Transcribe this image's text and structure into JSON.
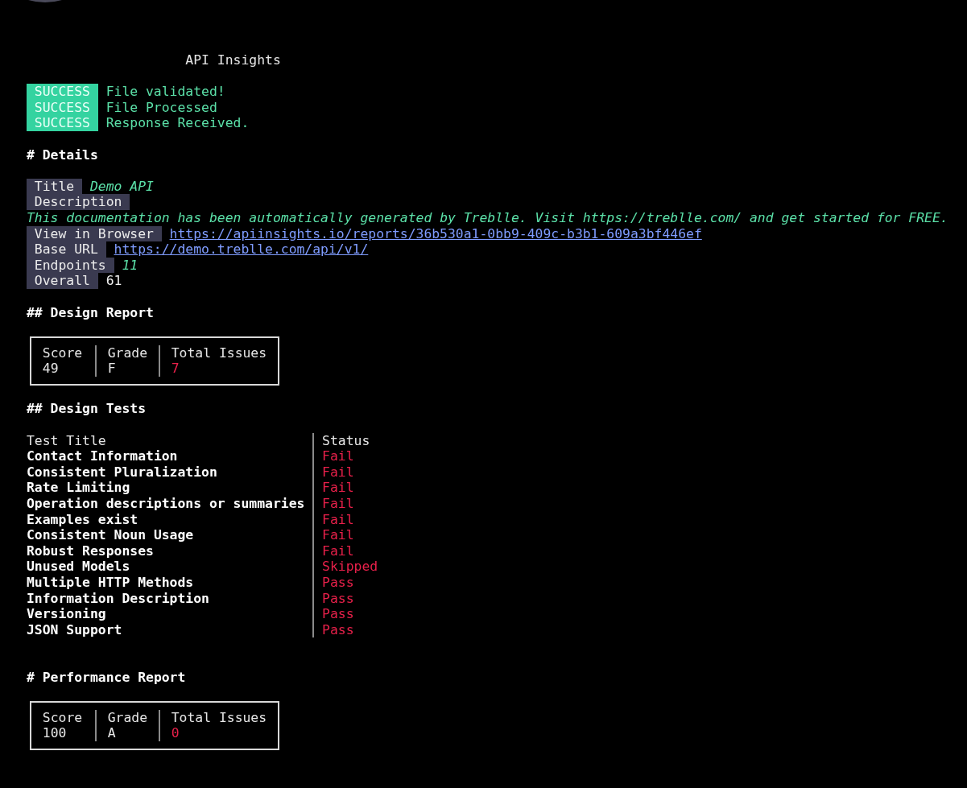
{
  "title": "API Insights",
  "log": [
    {
      "badge": "SUCCESS",
      "message": "File validated!"
    },
    {
      "badge": "SUCCESS",
      "message": "File Processed"
    },
    {
      "badge": "SUCCESS",
      "message": "Response Received."
    }
  ],
  "details": {
    "heading": "# Details",
    "fields": [
      {
        "label": "Title",
        "value": "Demo API",
        "kind": "italic"
      },
      {
        "label": "Description",
        "value": "This documentation has been automatically generated by Treblle. Visit https://treblle.com/ and get started for FREE.",
        "kind": "block"
      },
      {
        "label": "View in Browser",
        "value": "https://apiinsights.io/reports/36b530a1-0bb9-409c-b3b1-609a3bf446ef",
        "kind": "link"
      },
      {
        "label": "Base URL",
        "value": "https://demo.treblle.com/api/v1/",
        "kind": "link"
      },
      {
        "label": "Endpoints",
        "value": "11",
        "kind": "italic"
      },
      {
        "label": "Overall",
        "value": "61",
        "kind": "plain"
      }
    ]
  },
  "design_report": {
    "heading": "## Design Report",
    "columns": [
      "Score",
      "Grade",
      "Total Issues"
    ],
    "values": [
      "49",
      "F",
      "7"
    ]
  },
  "design_tests": {
    "heading": "## Design Tests",
    "columns": [
      "Test Title",
      "Status"
    ],
    "rows": [
      {
        "title": "Contact Information",
        "status": "Fail"
      },
      {
        "title": "Consistent Pluralization",
        "status": "Fail"
      },
      {
        "title": "Rate Limiting",
        "status": "Fail"
      },
      {
        "title": "Operation descriptions or summaries",
        "status": "Fail"
      },
      {
        "title": "Examples exist",
        "status": "Fail"
      },
      {
        "title": "Consistent Noun Usage",
        "status": "Fail"
      },
      {
        "title": "Robust Responses",
        "status": "Fail"
      },
      {
        "title": "Unused Models",
        "status": "Skipped"
      },
      {
        "title": "Multiple HTTP Methods",
        "status": "Pass"
      },
      {
        "title": "Information Description",
        "status": "Pass"
      },
      {
        "title": "Versioning",
        "status": "Pass"
      },
      {
        "title": "JSON Support",
        "status": "Pass"
      }
    ]
  },
  "performance_report": {
    "heading": "# Performance Report",
    "columns": [
      "Score",
      "Grade",
      "Total Issues"
    ],
    "values": [
      "100",
      "A",
      "0"
    ]
  }
}
